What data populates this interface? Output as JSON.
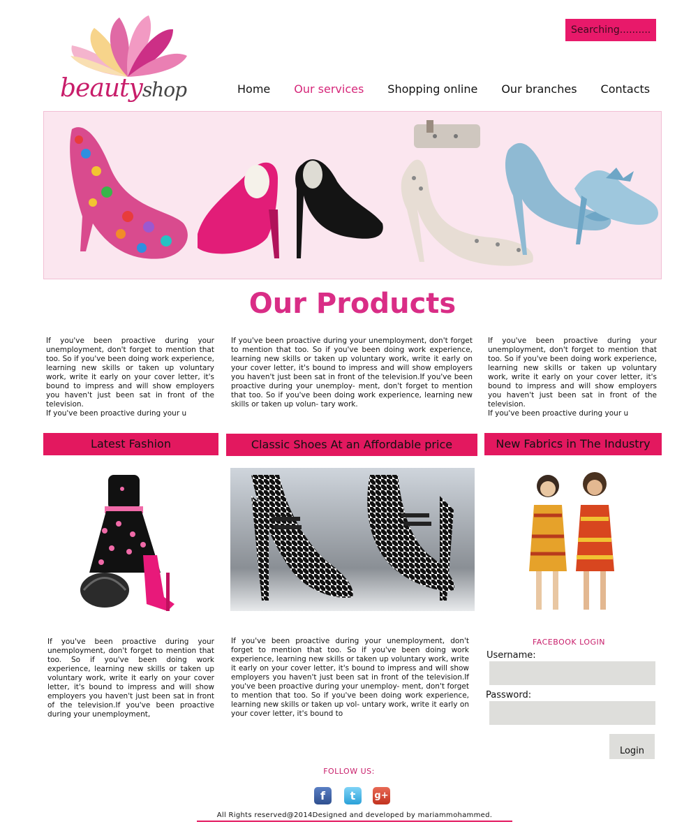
{
  "brand": {
    "logo_text_1": "beauty",
    "logo_text_2": "shop"
  },
  "search": {
    "value": "Searching.........."
  },
  "nav": {
    "items": [
      "Home",
      "Our services",
      "Shopping online",
      "Our branches",
      "Contacts"
    ],
    "active_index": 1
  },
  "main": {
    "title": "Our Products",
    "paragraphs": {
      "p1": "If you've been proactive during your unemployment, don't forget to mention that too. So if you've been doing work experience, learning new skills or taken up voluntary work, write it early on your cover letter, it's bound to impress and will show employers you haven't just been sat in front of the television.",
      "p1_tail": "If you've been proactive during your u",
      "p2": "If you've been proactive during your unemployment, don't forget to mention that too. So if you've been doing work experience, learning new skills or taken up voluntary work, write it early on your cover letter, it's bound to impress and will show employers you haven't just been sat in front of the television.If you've been proactive during your unemploy- ment, don't forget to mention that too. So if you've been doing work experience, learning new skills or taken up volun- tary work.",
      "p3": "If you've been proactive during your unemployment, don't forget to mention that too. So if you've been doing work experience, learning new skills or taken up voluntary work, write it early on your cover letter, it's bound to impress and will show employers you haven't just been sat in front of the television.",
      "p3_tail": "If you've been proactive during your u",
      "p4": "If you've been proactive during your unemployment, don't forget to mention that too. So if you've been doing work experience, learning new skills or taken up voluntary work, write it early on your cover letter, it's bound to impress and will show employers you haven't just been sat in front of the television.If you've been proactive during your unemployment,",
      "p5": "If you've been proactive during your unemployment, don't forget to mention that too. So if you've been doing work experience, learning new skills or taken up voluntary work, write it early on your cover letter, it's bound to impress and will show employers you haven't just been sat in front of the television.If you've been proactive during your unemploy- ment, don't forget to mention that too. So if you've been doing work experience, learning new skills or taken up vol- untary work, write it early on your cover letter, it's bound to"
    },
    "sections": [
      "Latest Fashion",
      "Classic Shoes At an Affordable price",
      "New Fabrics in The Industry"
    ]
  },
  "login": {
    "title": "FACEBOOK LOGIN",
    "username_label": "Username:",
    "password_label": "Password:",
    "username_value": "",
    "password_value": "",
    "button": "Login"
  },
  "footer": {
    "follow": "FOLLOW US:",
    "social": [
      {
        "name": "facebook-icon",
        "glyph": "f"
      },
      {
        "name": "twitter-icon",
        "glyph": "t"
      },
      {
        "name": "google-plus-icon",
        "glyph": "g+"
      }
    ],
    "copyright": "All Rights reserved@2014Designed and developed by mariammohammed."
  },
  "colors": {
    "accent": "#e3185f",
    "title": "#d92d86",
    "banner_bg": "#fbe6ef",
    "field_bg": "#dededb"
  }
}
